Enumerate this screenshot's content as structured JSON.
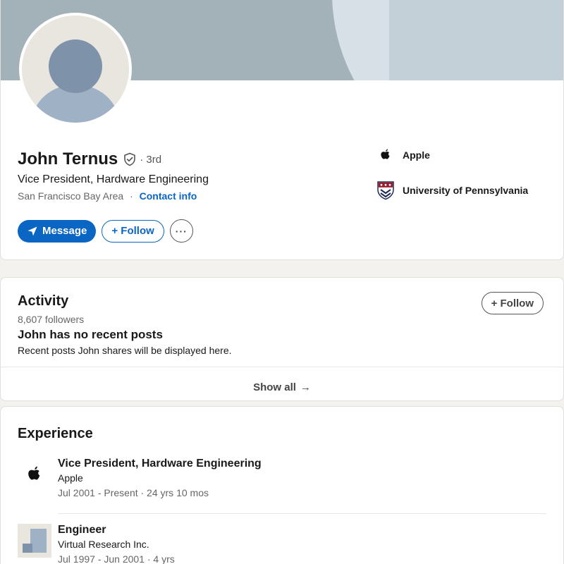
{
  "profile": {
    "name": "John Ternus",
    "degree": "· 3rd",
    "headline": "Vice President, Hardware Engineering",
    "location": "San Francisco Bay Area",
    "separator": "·",
    "contact_label": "Contact info",
    "message_label": "Message",
    "follow_label": "+ Follow",
    "more_label": "···",
    "orgs": [
      {
        "name": "Apple",
        "icon": "apple-logo-icon"
      },
      {
        "name": "University of Pennsylvania",
        "icon": "upenn-shield-icon"
      }
    ]
  },
  "activity": {
    "title": "Activity",
    "followers": "8,607 followers",
    "follow_label": "+ Follow",
    "empty_title": "John has no recent posts",
    "empty_subtitle": "Recent posts John shares will be displayed here.",
    "show_all_label": "Show all",
    "show_all_arrow": "→"
  },
  "experience": {
    "title": "Experience",
    "items": [
      {
        "title": "Vice President, Hardware Engineering",
        "company": "Apple",
        "dates": "Jul 2001 - Present · 24 yrs 10 mos",
        "icon": "apple-logo-icon"
      },
      {
        "title": "Engineer",
        "company": "Virtual Research Inc.",
        "dates": "Jul 1997 - Jun 2001 · 4 yrs",
        "icon": "company-placeholder-icon"
      }
    ]
  },
  "colors": {
    "brand_blue": "#0a66c2",
    "page_bg": "#f4f2ee",
    "banner": "#a3b1b8"
  }
}
